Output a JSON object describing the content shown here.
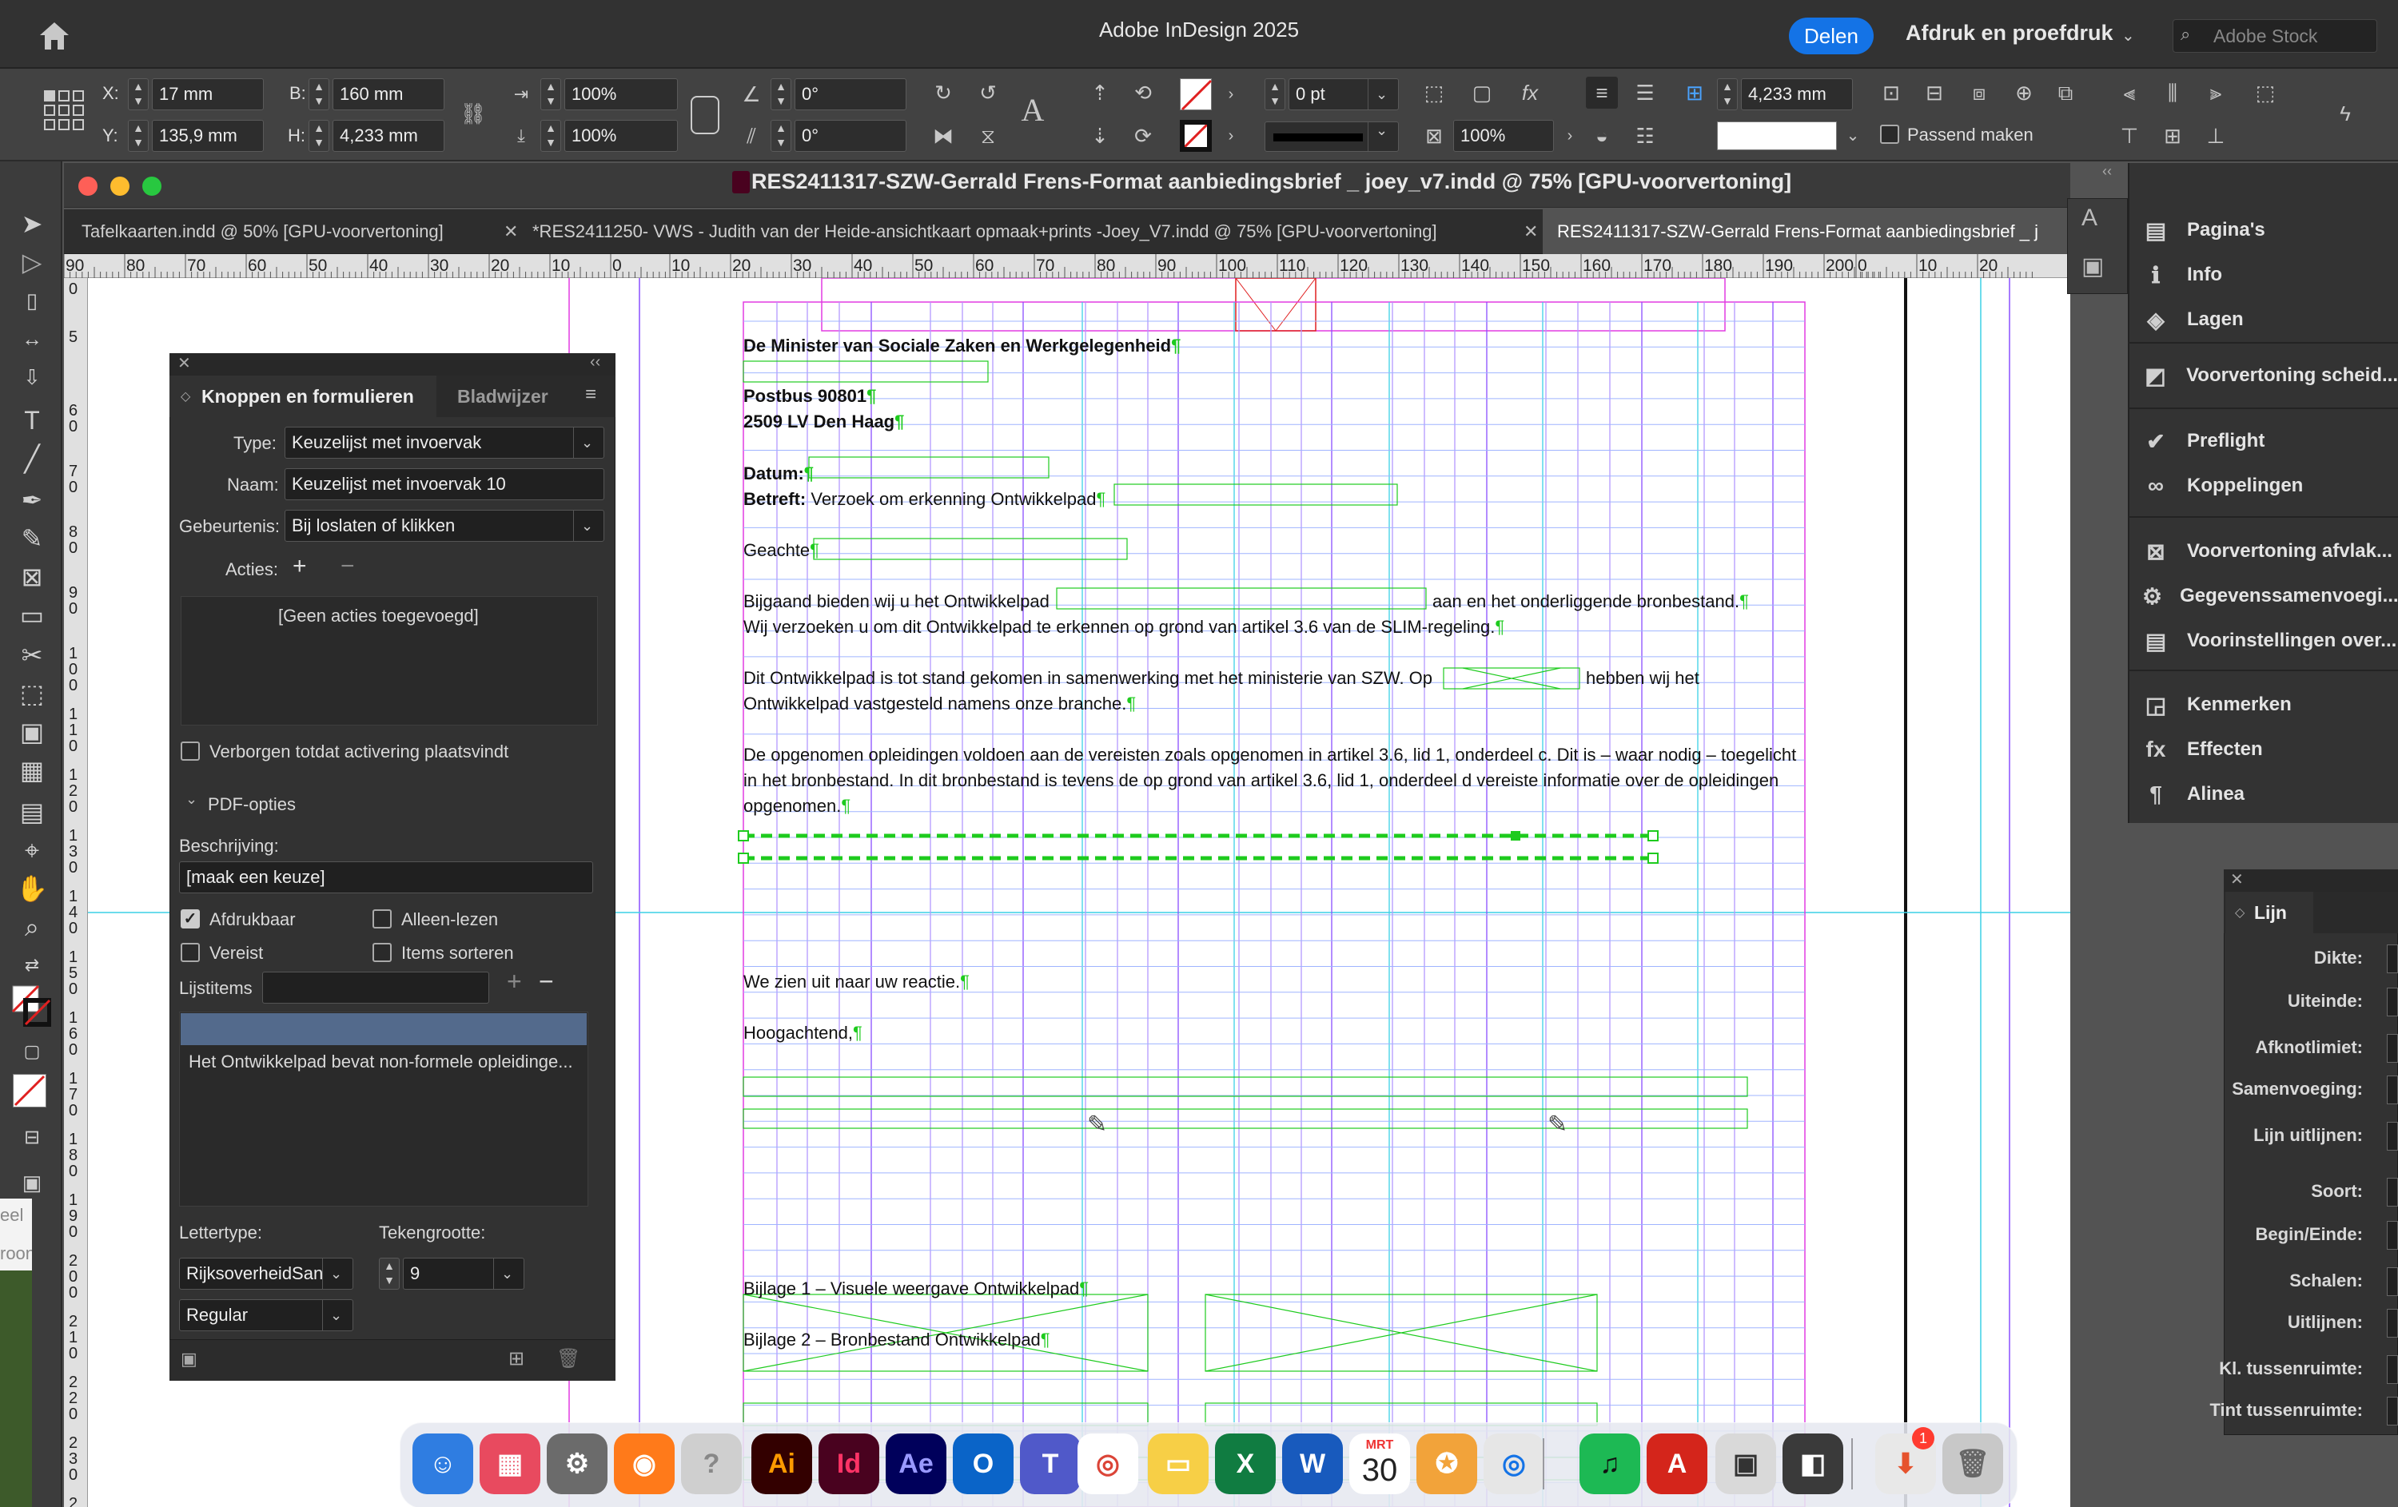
{
  "app": {
    "title": "Adobe InDesign 2025",
    "share_label": "Delen",
    "print_menu_label": "Afdruk en proefdruk",
    "stock_placeholder": "Adobe Stock"
  },
  "control_bar": {
    "x_label": "X:",
    "x_value": "17 mm",
    "y_label": "Y:",
    "y_value": "135,9 mm",
    "w_label": "B:",
    "w_value": "160 mm",
    "h_label": "H:",
    "h_value": "4,233 mm",
    "scale_x": "100%",
    "scale_y": "100%",
    "rotate": "0°",
    "shear": "0°",
    "stroke_weight": "0 pt",
    "opacity": "100%",
    "dimension": "4,233 mm",
    "fit_label": "Passend maken"
  },
  "document": {
    "window_title": "RES2411317-SZW-Gerrald Frens-Format aanbiedingsbrief _ joey_v7.indd @ 75% [GPU-voorvertoning]",
    "tabs": [
      {
        "label": "Tafelkaarten.indd @ 50% [GPU-voorvertoning]"
      },
      {
        "label": "*RES2411250- VWS - Judith van der Heide-ansichtkaart opmaak+prints -Joey_V7.indd @ 75% [GPU-voorvertoning]"
      },
      {
        "label": "RES2411317-SZW-Gerrald Frens-Format aanbiedingsbrief _ j"
      }
    ],
    "ruler_h": [
      "90",
      "80",
      "70",
      "60",
      "50",
      "40",
      "30",
      "20",
      "10",
      "0",
      "10",
      "20",
      "30",
      "40",
      "50",
      "60",
      "70",
      "80",
      "90",
      "100",
      "110",
      "120",
      "130",
      "140",
      "150",
      "160",
      "170",
      "180",
      "190",
      "200",
      "0",
      "10",
      "20"
    ],
    "ruler_v": [
      "0",
      "5",
      "6\n0",
      "7\n0",
      "8\n0",
      "9\n0",
      "1\n0\n0",
      "1\n1\n0",
      "1\n2\n0",
      "1\n3\n0",
      "1\n4\n0",
      "1\n5\n0",
      "1\n6\n0",
      "1\n7\n0",
      "1\n8\n0",
      "1\n9\n0",
      "2\n0\n0",
      "2\n1\n0",
      "2\n2\n0",
      "2\n3\n0",
      "2\n4\n0"
    ],
    "letter": {
      "addressee": "De Minister van Sociale Zaken en Werkgelegenheid",
      "postbus": "Postbus 90801",
      "city": "2509 LV Den Haag",
      "date_label": "Datum:",
      "subject_label": "Betreft:",
      "subject": "Verzoek om erkenning Ontwikkelpad",
      "salutation": "Geachte",
      "p1a": "Bijgaand bieden wij u het Ontwikkelpad",
      "p1b": "aan en het onderliggende bronbestand.",
      "p1c": "Wij verzoeken u om dit Ontwikkelpad te erkennen op grond van artikel 3.6 van de SLIM-regeling.",
      "p2a": "Dit Ontwikkelpad is tot stand gekomen in samenwerking met het ministerie van SZW. Op",
      "p2b": "hebben wij het",
      "p2c": "Ontwikkelpad vastgesteld namens onze branche.",
      "p3a": "De opgenomen opleidingen voldoen aan de vereisten zoals opgenomen in artikel 3.6, lid 1, onderdeel c. Dit is – waar nodig – toegelicht",
      "p3b": "in het bronbestand. In dit bronbestand is tevens de op grond van artikel 3.6, lid 1, onderdeel d vereiste informatie over de opleidingen",
      "p3c": "opgenomen.",
      "closing1": "We zien uit naar uw reactie.",
      "closing2": "Hoogachtend,",
      "annex1": "Bijlage 1 – Visuele weergave Ontwikkelpad",
      "annex2": "Bijlage 2 – Bronbestand Ontwikkelpad",
      "pilcrow": "¶"
    },
    "side_text": [
      "eel",
      "roon"
    ]
  },
  "buttons_panel": {
    "tab_active": "Knoppen en formulieren",
    "tab_inactive": "Bladwijzer",
    "type_label": "Type:",
    "type_value": "Keuzelijst met invoervak",
    "name_label": "Naam:",
    "name_value": "Keuzelijst met invoervak 10",
    "event_label": "Gebeurtenis:",
    "event_value": "Bij loslaten of klikken",
    "actions_label": "Acties:",
    "no_actions": "[Geen acties toegevoegd]",
    "hidden_label": "Verborgen totdat activering plaatsvindt",
    "pdf_options": "PDF-opties",
    "desc_label": "Beschrijving:",
    "desc_value": "[maak een keuze]",
    "printable": "Afdrukbaar",
    "readonly": "Alleen-lezen",
    "required": "Vereist",
    "sort": "Items sorteren",
    "list_items_label": "Lijstitems",
    "list_item_1": "Het Ontwikkelpad bevat non-formele opleidinge...",
    "font_label": "Lettertype:",
    "size_label": "Tekengrootte:",
    "font_value": "RijksoverheidSans",
    "size_value": "9",
    "style_value": "Regular"
  },
  "right_dock": {
    "items": [
      {
        "label": "Pagina's",
        "icon": "pages-icon"
      },
      {
        "label": "Info",
        "icon": "info-icon"
      },
      {
        "label": "Lagen",
        "icon": "layers-icon"
      },
      {
        "label": "Voorvertoning scheid...",
        "icon": "separations-icon"
      },
      {
        "label": "Preflight",
        "icon": "preflight-icon"
      },
      {
        "label": "Koppelingen",
        "icon": "links-icon"
      },
      {
        "label": "Voorvertoning afvlak...",
        "icon": "flattener-icon"
      },
      {
        "label": "Gegevenssamenvoegi...",
        "icon": "datamerge-icon"
      },
      {
        "label": "Voorinstellingen over...",
        "icon": "presets-icon"
      },
      {
        "label": "Kenmerken",
        "icon": "attributes-icon"
      },
      {
        "label": "Effecten",
        "icon": "effects-icon"
      },
      {
        "label": "Alinea",
        "icon": "paragraph-icon"
      }
    ]
  },
  "stroke_panel": {
    "title": "Lijn",
    "rows": [
      "Dikte:",
      "Uiteinde:",
      "Afknotlimiet:",
      "Samenvoeging:",
      "Lijn uitlijnen:",
      "Soort:",
      "Begin/Einde:",
      "Schalen:",
      "Uitlijnen:",
      "Kl. tussenruimte:",
      "Tint tussenruimte:"
    ]
  },
  "mac_dock": {
    "calendar_month": "MRT",
    "calendar_day": "30",
    "badge": "1",
    "apps": [
      "Finder",
      "Launchpad",
      "Systeeminstellingen",
      "Firefox",
      "Help",
      "Illustrator",
      "InDesign",
      "After Effects",
      "Outlook",
      "Teams",
      "Chrome",
      "Notities",
      "Excel",
      "Word",
      "Agenda",
      "Wachtwoorden",
      "Netwerk",
      "Spotify",
      "Acrobat",
      "Preview",
      "Software Update",
      "Downloads",
      "Prullenmand"
    ]
  },
  "colors": {
    "accent": "#1473e6",
    "guide_green": "#1ecb1e",
    "guide_violet": "#8a4fff",
    "margin_magenta": "#e23be2",
    "selection_cyan": "#3bd1e6"
  }
}
